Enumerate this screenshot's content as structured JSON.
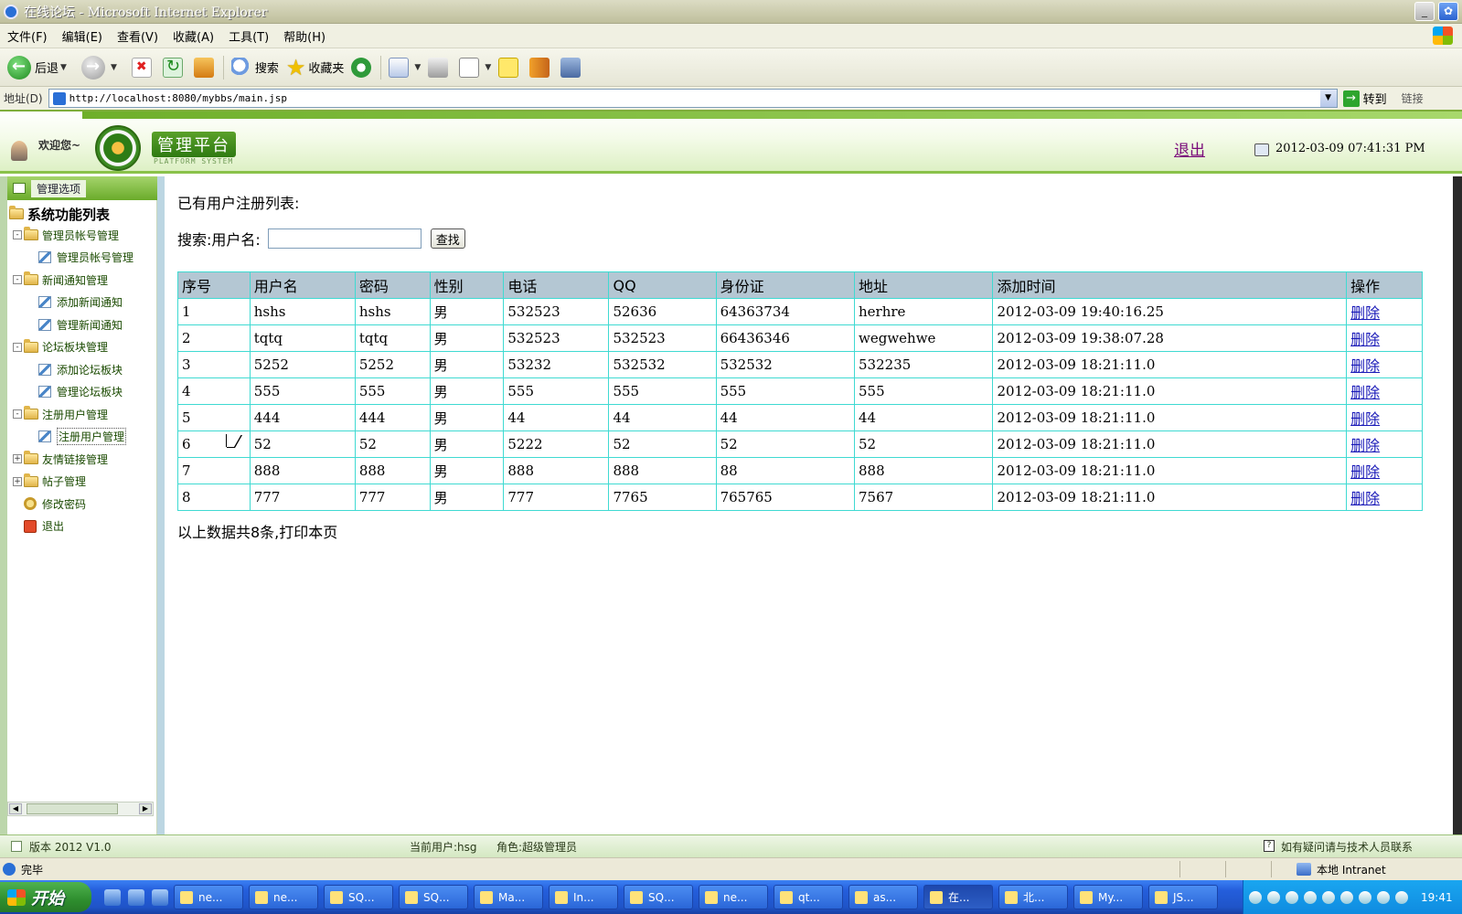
{
  "window": {
    "title": "在线论坛 - Microsoft Internet Explorer",
    "controls": [
      "_",
      ""
    ]
  },
  "menu": {
    "items": [
      "文件(F)",
      "编辑(E)",
      "查看(V)",
      "收藏(A)",
      "工具(T)",
      "帮助(H)"
    ]
  },
  "toolbar": {
    "back_label": "后退",
    "search_label": "搜索",
    "favorites_label": "收藏夹"
  },
  "address": {
    "label": "地址(D)",
    "url": "http://localhost:8080/mybbs/main.jsp",
    "go_label": "转到",
    "links_label": "链接"
  },
  "header": {
    "welcome": "欢迎您~",
    "platform_title": "管理平台",
    "platform_subtitle": "PLATFORM SYSTEM",
    "logout": "退出",
    "datetime": "2012-03-09 07:41:31 PM"
  },
  "sidebar": {
    "tab_label": "管理选项",
    "root": "系统功能列表",
    "items": [
      {
        "label": "管理员帐号管理",
        "level": 1,
        "expander": "-"
      },
      {
        "label": "管理员帐号管理",
        "level": 2
      },
      {
        "label": "新闻通知管理",
        "level": 1,
        "expander": "-"
      },
      {
        "label": "添加新闻通知",
        "level": 2
      },
      {
        "label": "管理新闻通知",
        "level": 2
      },
      {
        "label": "论坛板块管理",
        "level": 1,
        "expander": "-"
      },
      {
        "label": "添加论坛板块",
        "level": 2
      },
      {
        "label": "管理论坛板块",
        "level": 2
      },
      {
        "label": "注册用户管理",
        "level": 1,
        "expander": "-"
      },
      {
        "label": "注册用户管理",
        "level": 2,
        "selected": true
      },
      {
        "label": "友情链接管理",
        "level": 1,
        "expander": "+"
      },
      {
        "label": "帖子管理",
        "level": 1,
        "expander": "+"
      },
      {
        "label": "修改密码",
        "level": 1,
        "icon": "key"
      },
      {
        "label": "退出",
        "level": 1,
        "icon": "exit"
      }
    ]
  },
  "main": {
    "heading": "已有用户注册列表:",
    "search_label": "搜索:用户名:",
    "search_value": "",
    "search_button": "查找",
    "columns": [
      "序号",
      "用户名",
      "密码",
      "性别",
      "电话",
      "QQ",
      "身份证",
      "地址",
      "添加时间",
      "操作"
    ],
    "rows": [
      [
        "1",
        "hshs",
        "hshs",
        "男",
        "532523",
        "52636",
        "64363734",
        "herhre",
        "2012-03-09 19:40:16.25",
        "删除"
      ],
      [
        "2",
        "tqtq",
        "tqtq",
        "男",
        "532523",
        "532523",
        "66436346",
        "wegwehwe",
        "2012-03-09 19:38:07.28",
        "删除"
      ],
      [
        "3",
        "5252",
        "5252",
        "男",
        "53232",
        "532532",
        "532532",
        "532235",
        "2012-03-09 18:21:11.0",
        "删除"
      ],
      [
        "4",
        "555",
        "555",
        "男",
        "555",
        "555",
        "555",
        "555",
        "2012-03-09 18:21:11.0",
        "删除"
      ],
      [
        "5",
        "444",
        "444",
        "男",
        "44",
        "44",
        "44",
        "44",
        "2012-03-09 18:21:11.0",
        "删除"
      ],
      [
        "6",
        "52",
        "52",
        "男",
        "5222",
        "52",
        "52",
        "52",
        "2012-03-09 18:21:11.0",
        "删除"
      ],
      [
        "7",
        "888",
        "888",
        "男",
        "888",
        "888",
        "88",
        "888",
        "2012-03-09 18:21:11.0",
        "删除"
      ],
      [
        "8",
        "777",
        "777",
        "男",
        "777",
        "7765",
        "765765",
        "7567",
        "2012-03-09 18:21:11.0",
        "删除"
      ]
    ],
    "summary": "以上数据共8条,打印本页"
  },
  "footer": {
    "version": "版本 2012 V1.0",
    "current_user": "当前用户:hsg",
    "role": "角色:超级管理员",
    "contact": "如有疑问请与技术人员联系"
  },
  "statusbar": {
    "status": "完毕",
    "zone": "本地 Intranet"
  },
  "taskbar": {
    "start": "开始",
    "tasks": [
      "ne...",
      "ne...",
      "SQ...",
      "SQ...",
      "Ma...",
      "In...",
      "SQ...",
      "ne...",
      "qt...",
      "as...",
      "在...",
      "北...",
      "My...",
      "JS..."
    ],
    "active_index": 10,
    "clock": "19:41"
  }
}
